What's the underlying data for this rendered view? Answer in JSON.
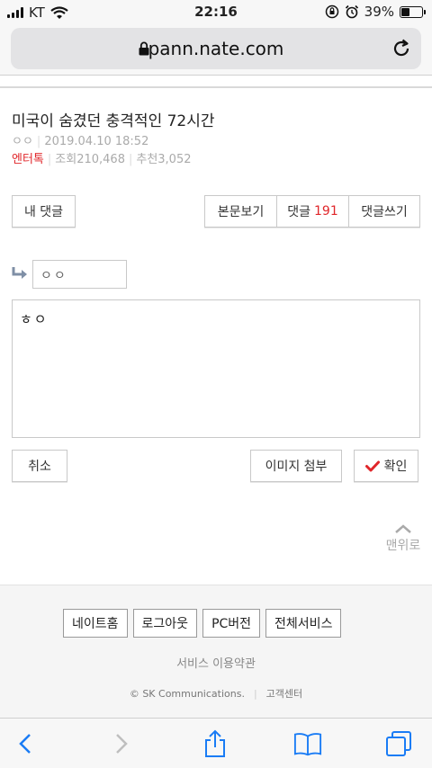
{
  "status_bar": {
    "carrier": "KT",
    "time": "22:16",
    "battery": "39%",
    "battery_level": 0.39
  },
  "browser": {
    "url": "pann.nate.com"
  },
  "post": {
    "title": "미국이 숨겼던 충격적인 72시간",
    "author": "ㅇㅇ",
    "date": "2019.04.10 18:52",
    "category": "엔터톡",
    "views_label": "조회",
    "views": "210,468",
    "recommend_label": "추천",
    "recommend": "3,052"
  },
  "buttons": {
    "my_comments": "내 댓글",
    "view_post": "본문보기",
    "comments": "댓글",
    "comments_count": "191",
    "write_comment": "댓글쓰기",
    "cancel": "취소",
    "attach_image": "이미지 첨부",
    "confirm": "확인",
    "to_top": "맨위로"
  },
  "reply_form": {
    "nickname_value": "ㅇㅇ",
    "comment_value": "ㅎㅇ"
  },
  "footer": {
    "links": [
      "네이트홈",
      "로그아웃",
      "PC버전",
      "전체서비스"
    ],
    "terms": "서비스 이용약관",
    "copyright": "© SK Communications.",
    "support": "고객센터"
  },
  "colors": {
    "accent_red": "#e0262a",
    "ios_blue": "#1a7cf5"
  },
  "icons": [
    "lock-icon",
    "reload-icon",
    "reply-arrow-icon",
    "check-icon",
    "chevron-up-icon",
    "back-icon",
    "forward-icon",
    "share-icon",
    "bookmarks-icon",
    "tabs-icon"
  ]
}
